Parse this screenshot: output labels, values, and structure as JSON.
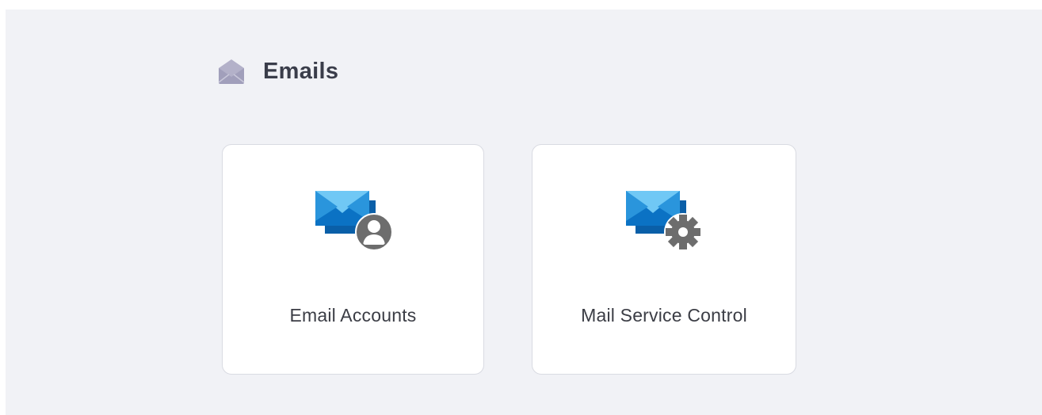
{
  "section": {
    "title": "Emails",
    "icon": "envelope-open-icon",
    "icon_color": "#a4a2bd"
  },
  "cards": [
    {
      "label": "Email Accounts",
      "icon": "email-user-icon"
    },
    {
      "label": "Mail Service Control",
      "icon": "email-settings-icon"
    }
  ],
  "colors": {
    "background": "#f1f2f6",
    "card": "#ffffff",
    "envelope_light": "#70c8f5",
    "envelope_dark": "#0b72c4",
    "badge_gray": "#6d6d6d"
  }
}
